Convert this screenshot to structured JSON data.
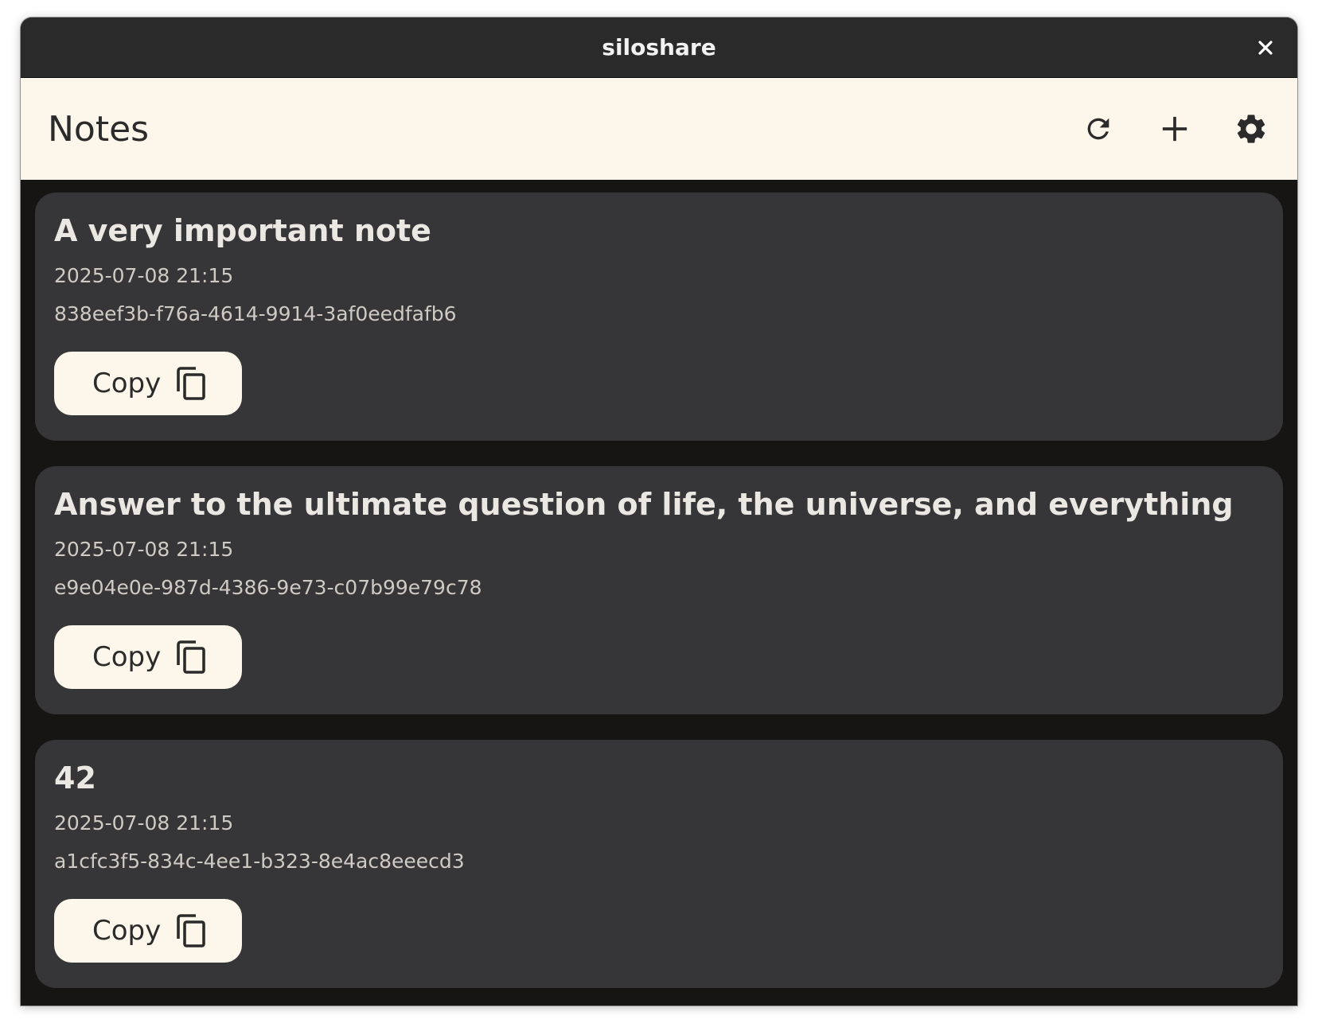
{
  "window": {
    "title": "siloshare",
    "close_icon": "close-icon"
  },
  "appbar": {
    "title": "Notes",
    "actions": [
      {
        "name": "refresh",
        "icon": "refresh-icon"
      },
      {
        "name": "add",
        "icon": "plus-icon"
      },
      {
        "name": "settings",
        "icon": "gear-icon"
      }
    ]
  },
  "notes": [
    {
      "title": "A very important note",
      "date": "2025-07-08 21:15",
      "id": "838eef3b-f76a-4614-9914-3af0eedfafb6",
      "copy_label": "Copy"
    },
    {
      "title": "Answer to the ultimate question of life, the universe, and everything",
      "date": "2025-07-08 21:15",
      "id": "e9e04e0e-987d-4386-9e73-c07b99e79c78",
      "copy_label": "Copy"
    },
    {
      "title": "42",
      "date": "2025-07-08 21:15",
      "id": "a1cfc3f5-834c-4ee1-b323-8e4ac8eeecd3",
      "copy_label": "Copy"
    }
  ],
  "colors": {
    "titlebar": "#2a2a2a",
    "appbar": "#fdf6ea",
    "background": "#161514",
    "card": "#363537",
    "button": "#fdf6ea"
  }
}
